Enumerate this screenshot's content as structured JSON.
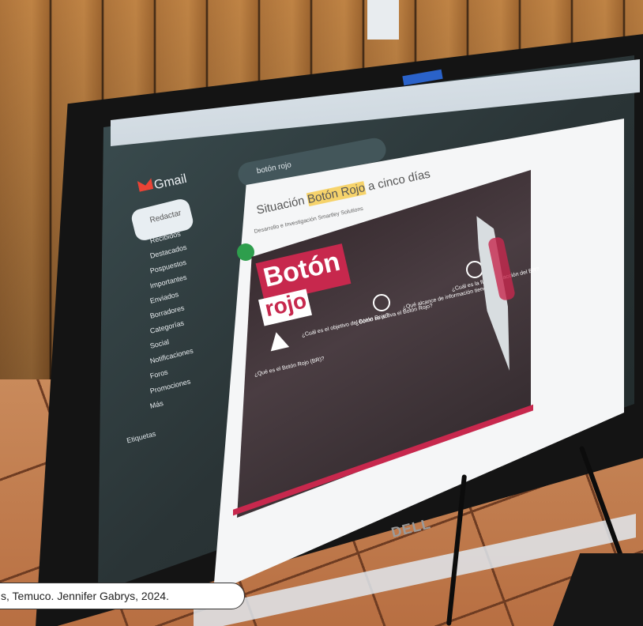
{
  "photo": {
    "description_free": true
  },
  "browser": {
    "active_tab_hint": ""
  },
  "gmail": {
    "app_name": "Gmail",
    "compose_label": "Redactar",
    "search_query": "botón rojo",
    "nav_items": [
      "Recibidos",
      "Destacados",
      "Pospuestos",
      "Importantes",
      "Enviados",
      "Borradores",
      "Categorías",
      "Social",
      "Notificaciones",
      "Foros",
      "Promociones",
      "Más"
    ],
    "labels_heading": "Etiquetas"
  },
  "email": {
    "subject_prefix": "Situación ",
    "subject_highlight": "Botón Rojo",
    "subject_suffix": " a cinco días",
    "sender": "Desarrollo e Investigación Smartley Solutions"
  },
  "infographic": {
    "title_line1": "Botón",
    "title_line2": "rojo",
    "questions": [
      "¿Qué es el Botón Rojo (BR)?",
      "¿Cuál es el objetivo del Botón Rojo?",
      "¿Cómo se activa el Botón Rojo?",
      "¿Qué alcance de información tiene?",
      "¿Cuál es la figura de acción del BR?"
    ]
  },
  "monitor": {
    "brand": "DELL"
  },
  "caption": {
    "text": "s, Temuco. Jennifer Gabrys, 2024."
  },
  "colors": {
    "accent_red": "#c7284d",
    "gmail_red": "#ea4335",
    "avatar_green": "#2e9e4d"
  }
}
